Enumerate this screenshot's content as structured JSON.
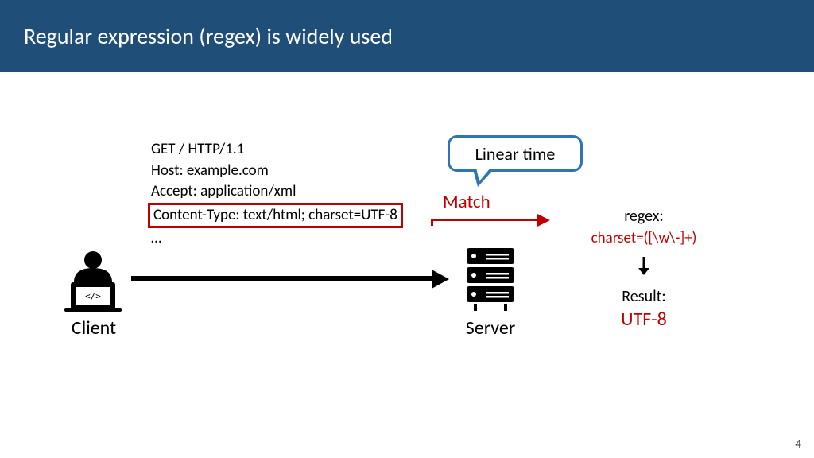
{
  "header": {
    "title": "Regular expression (regex) is widely used"
  },
  "http": {
    "line1": "GET / HTTP/1.1",
    "line2": "Host: example.com",
    "line3": "Accept: application/xml",
    "line4": "Content-Type: text/html; charset=UTF-8",
    "line5": "…"
  },
  "labels": {
    "client": "Client",
    "server": "Server",
    "match": "Match",
    "bubble": "Linear time"
  },
  "regex": {
    "title": "regex:",
    "pattern": "charset=([\\w\\-]+)",
    "result_label": "Result:",
    "result_value": "UTF-8"
  },
  "page": {
    "number": "4"
  }
}
